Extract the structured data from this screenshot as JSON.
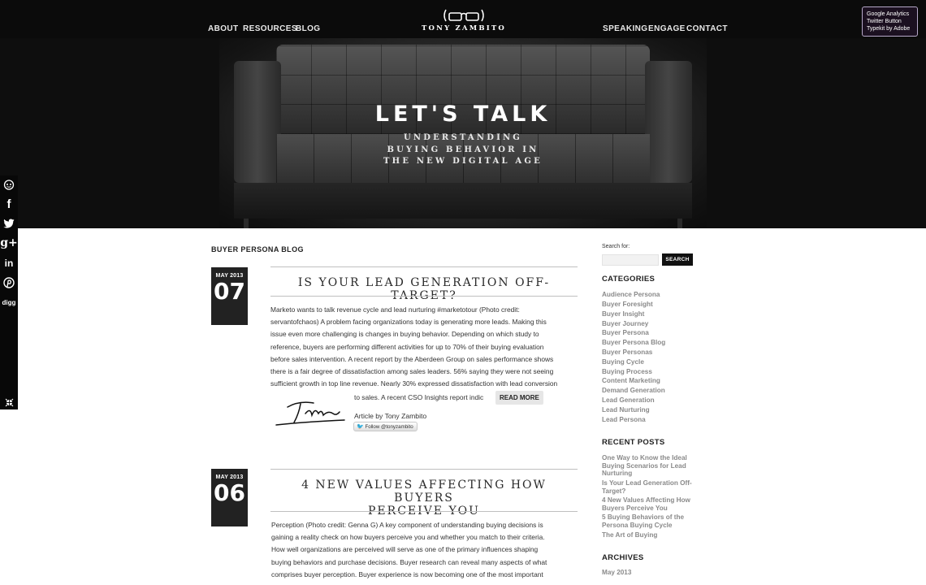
{
  "nav": {
    "left": [
      "ABOUT",
      "RESOURCES",
      "BLOG"
    ],
    "right": [
      "SPEAKING",
      "ENGAGE",
      "CONTACT"
    ],
    "logo_text": "TONY ZAMBITO"
  },
  "extension_badge": [
    "Google Analytics",
    "Twitter Button",
    "Typekit by Adobe"
  ],
  "hero": {
    "title": "LET'S TALK",
    "subtitle_lines": [
      "UNDERSTANDING",
      "BUYING BEHAVIOR IN",
      "THE NEW DIGITAL AGE"
    ]
  },
  "share_bar": {
    "icons": [
      "reddit-icon",
      "facebook-icon",
      "twitter-icon",
      "google-plus-icon",
      "linkedin-icon",
      "pinterest-icon",
      "digg-icon",
      "collapse-icon"
    ],
    "labels": {
      "facebook": "f",
      "google_plus": "g+",
      "linkedin": "in",
      "digg": "digg"
    }
  },
  "main": {
    "section_title": "BUYER PERSONA BLOG",
    "posts": [
      {
        "month": "MAY 2013",
        "day": "07",
        "title": "IS YOUR LEAD GENERATION OFF-TARGET?",
        "body_lines": [
          "Marketo wants to talk revenue cycle and lead nurturing #marketotour (Photo credit:",
          "servantofchaos) A problem facing organizations today is generating more leads.  Making this",
          "issue even more challenging is changes in buying behavior.  Depending on which study to",
          "reference, buyers are performing different activities for up to 70% of their buying evaluation",
          "before sales intervention. A recent report by the Aberdeen Group on sales performance shows",
          "there is a fair degree of dissatisfaction among sales leaders.  56% saying they were not seeing",
          "sufficient growth in top line revenue.  Nearly 30% expressed dissatisfaction with lead conversion"
        ],
        "tail": "to sales.  A recent CSO Insights report indic",
        "read_more": "READ MORE",
        "author": "Article by Tony Zambito",
        "follow": "Follow @tonyzambito"
      },
      {
        "month": "MAY 2013",
        "day": "06",
        "title_lines": [
          "4 NEW VALUES AFFECTING HOW BUYERS",
          "PERCEIVE YOU"
        ],
        "body_lines": [
          "Perception (Photo credit: Genna G) A key component of understanding buying decisions is",
          "gaining a reality check on how buyers perceive you and whether you match to their criteria.",
          "How well organizations are perceived will serve as one of the primary influences shaping",
          "buying behaviors and purchase decisions. Buyer research can reveal many aspects of what",
          "comprises buyer perception.  Buyer experience is now becoming one of the most important"
        ]
      }
    ]
  },
  "sidebar": {
    "search_label": "Search for:",
    "search_placeholder": "",
    "search_button": "SEARCH",
    "categories_title": "CATEGORIES",
    "categories": [
      "Audience Persona",
      "Buyer Foresight",
      "Buyer Insight",
      "Buyer Journey",
      "Buyer Persona",
      "Buyer Persona Blog",
      "Buyer Personas",
      "Buying Cycle",
      "Buying Process",
      "Content Marketing",
      "Demand Generation",
      "Lead Generation",
      "Lead Nurturing",
      "Lead Persona"
    ],
    "recent_title": "RECENT POSTS",
    "recent_posts": [
      "One Way to Know the Ideal Buying Scenarios for Lead Nurturing",
      "Is Your Lead Generation Off-Target?",
      "4 New Values Affecting How Buyers Perceive You",
      "5 Buying Behaviors of the Persona Buying Cycle",
      "The Art of Buying"
    ],
    "archives_title": "ARCHIVES",
    "archives": [
      "May 2013"
    ]
  },
  "colors": {
    "nav_bg": "#0b0b0b",
    "date_box": "#222222",
    "link_gray": "#8a8a8a",
    "search_button": "#111111",
    "twitter_bird": "#2ea4d8"
  }
}
